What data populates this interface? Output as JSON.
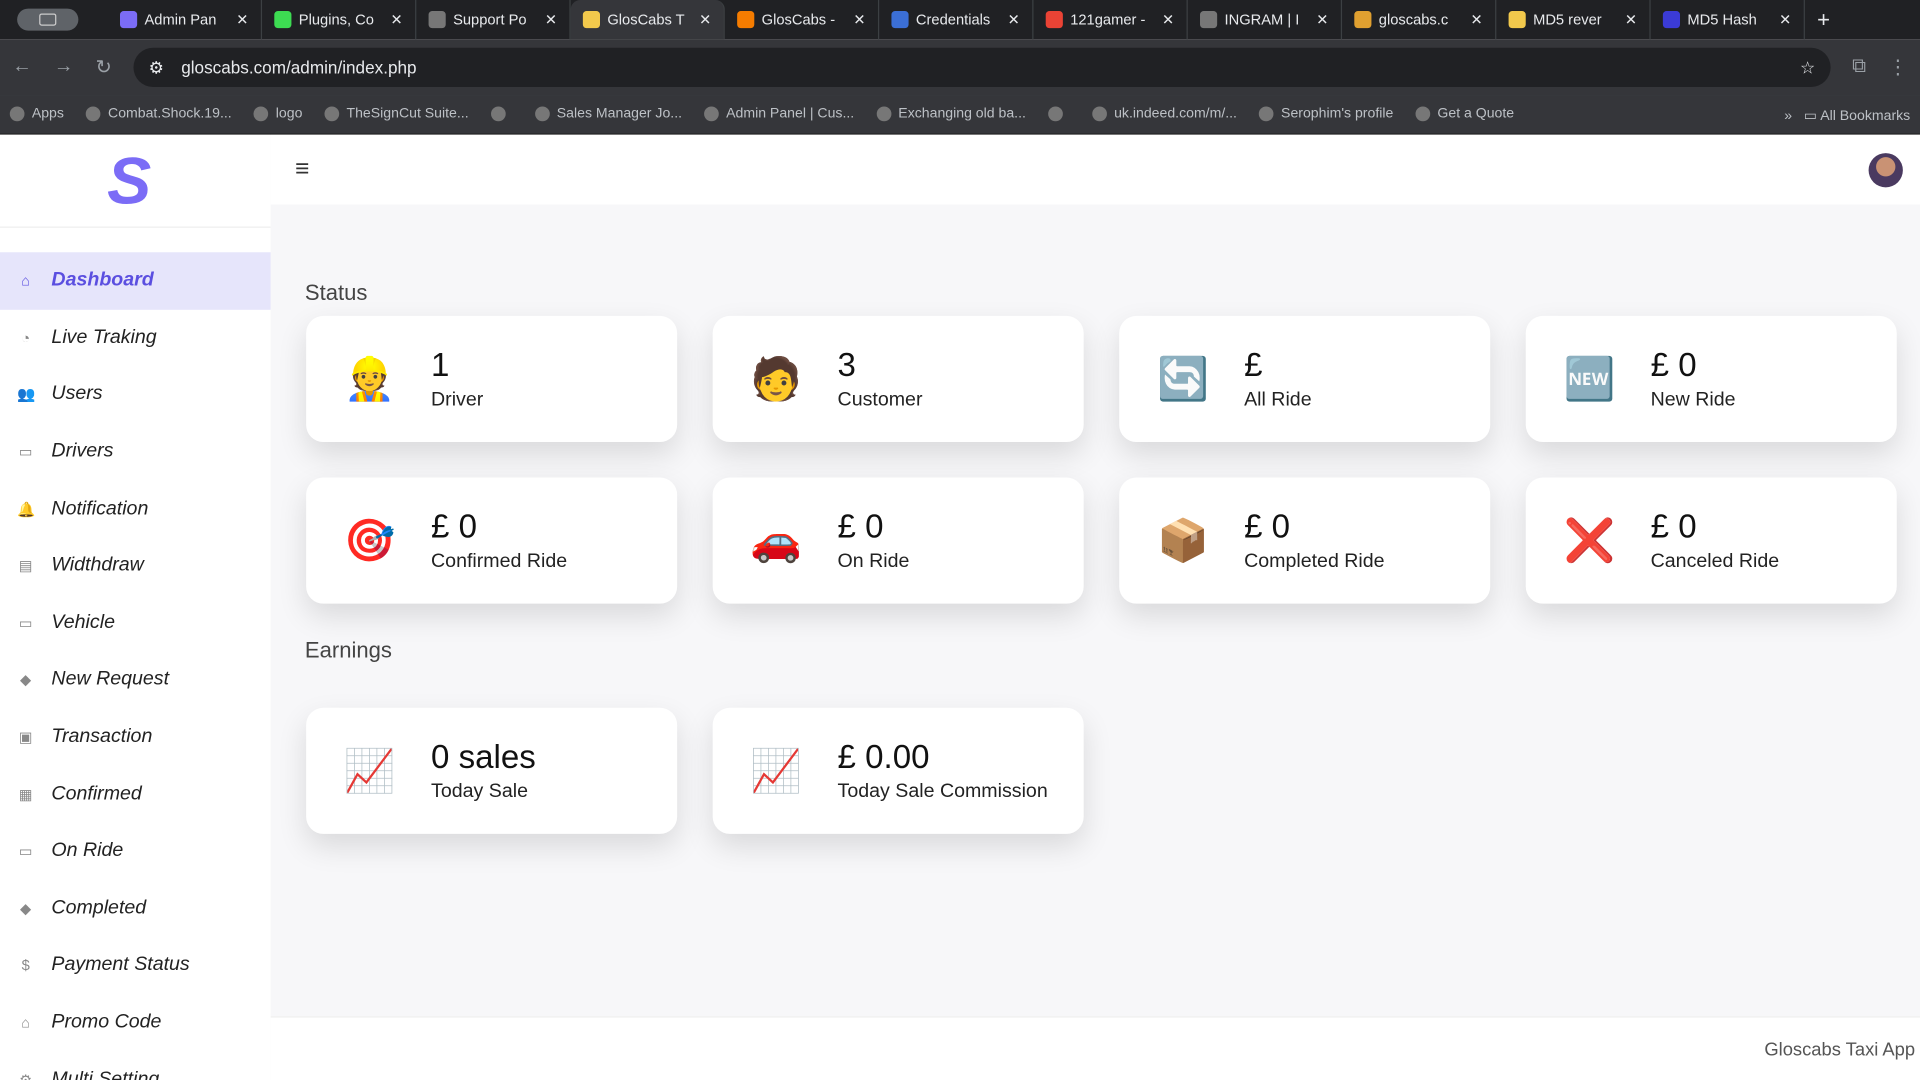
{
  "browser": {
    "tabs": [
      {
        "label": "Admin Pan",
        "icon": "admin-icon",
        "color": "#7b6cf6"
      },
      {
        "label": "Plugins, Co",
        "icon": "plugins-icon",
        "color": "#3ddc52"
      },
      {
        "label": "Support Po",
        "icon": "globe-icon",
        "color": "#777"
      },
      {
        "label": "GlosCabs T",
        "icon": "taxi-icon",
        "color": "#f2c94c",
        "active": true
      },
      {
        "label": "GlosCabs -",
        "icon": "fire-icon",
        "color": "#f57c00"
      },
      {
        "label": "Credentials",
        "icon": "api-icon",
        "color": "#3b6fd6"
      },
      {
        "label": "121gamer -",
        "icon": "google-icon",
        "color": "#ea4335"
      },
      {
        "label": "INGRAM | I",
        "icon": "globe-icon",
        "color": "#777"
      },
      {
        "label": "gloscabs.c",
        "icon": "site-icon",
        "color": "#e0a030"
      },
      {
        "label": "MD5 rever",
        "icon": "key-icon",
        "color": "#f2c94c"
      },
      {
        "label": "MD5 Hash",
        "icon": "md5-icon",
        "color": "#3b3bd6"
      }
    ],
    "url": "gloscabs.com/admin/index.php",
    "bookmarks": [
      "Apps",
      "Combat.Shock.19...",
      "logo",
      "TheSignCut Suite...",
      "",
      "Sales Manager Jo...",
      "Admin Panel | Cus...",
      "Exchanging old ba...",
      "",
      "uk.indeed.com/m/...",
      "Serophim's profile",
      "Get a Quote"
    ],
    "all_bookmarks": "All Bookmarks"
  },
  "logo": "S",
  "sidebar": {
    "items": [
      {
        "label": "Dashboard",
        "icon": "home-icon",
        "glyph": "⌂",
        "active": true
      },
      {
        "label": "Live Traking",
        "icon": "gauge-icon",
        "glyph": "◔"
      },
      {
        "label": "Users",
        "icon": "users-icon",
        "glyph": "👥"
      },
      {
        "label": "Drivers",
        "icon": "car-icon",
        "glyph": "▭"
      },
      {
        "label": "Notification",
        "icon": "bell-icon",
        "glyph": "🔔"
      },
      {
        "label": "Widthdraw",
        "icon": "wallet-icon",
        "glyph": "▤"
      },
      {
        "label": "Vehicle",
        "icon": "taxi-icon",
        "glyph": "▭"
      },
      {
        "label": "New Request",
        "icon": "tag-icon",
        "glyph": "◆"
      },
      {
        "label": "Transaction",
        "icon": "money-icon",
        "glyph": "▣"
      },
      {
        "label": "Confirmed",
        "icon": "list-icon",
        "glyph": "▦"
      },
      {
        "label": "On Ride",
        "icon": "car-icon",
        "glyph": "▭"
      },
      {
        "label": "Completed",
        "icon": "tag-icon",
        "glyph": "◆"
      },
      {
        "label": "Payment Status",
        "icon": "dollar-icon",
        "glyph": "$"
      },
      {
        "label": "Promo Code",
        "icon": "bank-icon",
        "glyph": "⌂"
      },
      {
        "label": "Multi Setting",
        "icon": "gear-icon",
        "glyph": "⚙"
      }
    ]
  },
  "status": {
    "title": "Status",
    "cards": [
      {
        "value": "1",
        "label": "Driver",
        "icon": "driver-icon",
        "glyph": "👷"
      },
      {
        "value": "3",
        "label": "Customer",
        "icon": "customer-icon",
        "glyph": "🧑"
      },
      {
        "value": "£",
        "label": "All Ride",
        "icon": "all-ride-icon",
        "glyph": "🔄"
      },
      {
        "value": "£ 0",
        "label": "New Ride",
        "icon": "new-badge-icon",
        "glyph": "🆕"
      },
      {
        "value": "£ 0",
        "label": "Confirmed Ride",
        "icon": "checklist-target-icon",
        "glyph": "🎯"
      },
      {
        "value": "£ 0",
        "label": "On Ride",
        "icon": "car-icon",
        "glyph": "🚗"
      },
      {
        "value": "£ 0",
        "label": "Completed Ride",
        "icon": "box-check-icon",
        "glyph": "📦"
      },
      {
        "value": "£ 0",
        "label": "Canceled Ride",
        "icon": "cancel-sign-icon",
        "glyph": "❌"
      }
    ]
  },
  "earnings": {
    "title": "Earnings",
    "cards": [
      {
        "value": "0 sales",
        "label": "Today Sale",
        "icon": "growth-chart-icon",
        "glyph": "📈"
      },
      {
        "value": "£ 0.00",
        "label": "Today Sale Commission",
        "icon": "growth-chart-icon",
        "glyph": "📈"
      }
    ]
  },
  "footer": "Gloscabs Taxi App"
}
